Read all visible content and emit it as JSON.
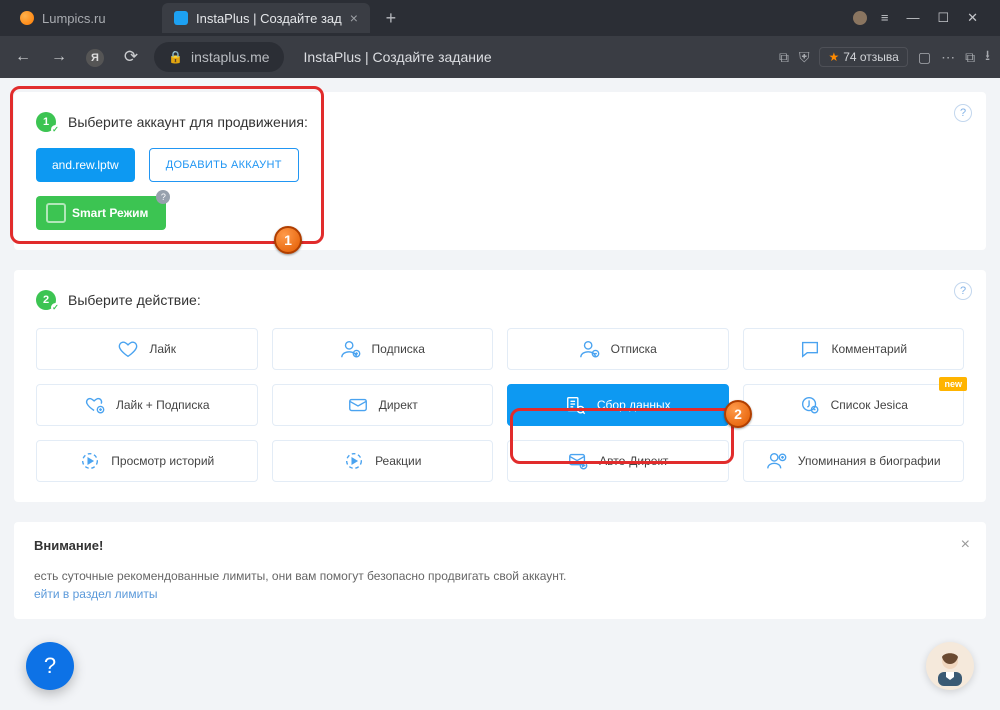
{
  "browser": {
    "tabs": [
      {
        "label": "Lumpics.ru",
        "active": false
      },
      {
        "label": "InstaPlus | Создайте зад",
        "active": true
      }
    ],
    "url_host": "instaplus.me",
    "page_title": "InstaPlus | Создайте задание",
    "rating": "74 отзыва"
  },
  "step1": {
    "number": "1",
    "title": "Выберите аккаунт для продвижения:",
    "account": "and.rew.lptw",
    "add_account": "ДОБАВИТЬ АККАУНТ",
    "smart_mode": "Smart Режим"
  },
  "step2": {
    "number": "2",
    "title": "Выберите действие:",
    "actions": [
      {
        "label": "Лайк",
        "icon": "heart"
      },
      {
        "label": "Подписка",
        "icon": "user-plus"
      },
      {
        "label": "Отписка",
        "icon": "user-minus"
      },
      {
        "label": "Комментарий",
        "icon": "comment"
      },
      {
        "label": "Лайк + Подписка",
        "icon": "heart-plus"
      },
      {
        "label": "Директ",
        "icon": "mail"
      },
      {
        "label": "Сбор данных",
        "icon": "collect",
        "selected": true
      },
      {
        "label": "Список Jesica",
        "icon": "list-j",
        "new_tag": "new"
      },
      {
        "label": "Просмотр историй",
        "icon": "play"
      },
      {
        "label": "Реакции",
        "icon": "play-heart"
      },
      {
        "label": "Авто-Директ",
        "icon": "auto-mail"
      },
      {
        "label": "Упоминания в биографии",
        "icon": "mention"
      }
    ]
  },
  "warning": {
    "title": "Внимание!",
    "text": "есть суточные рекомендованные лимиты, они вам помогут безопасно продвигать свой аккаунт.",
    "link": "ейти в раздел лимиты"
  },
  "annotations": {
    "b1": "1",
    "b2": "2"
  }
}
